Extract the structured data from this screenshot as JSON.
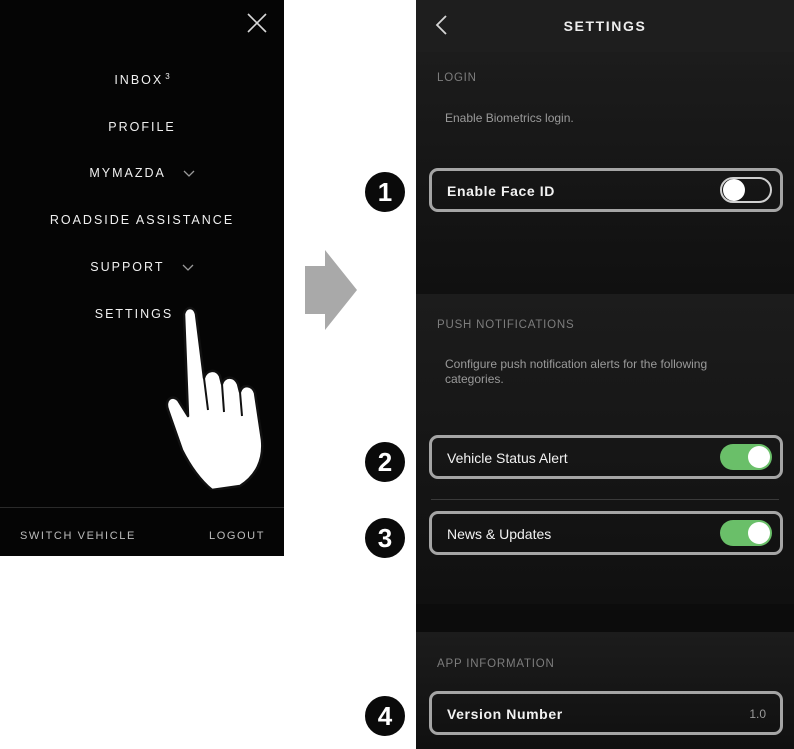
{
  "menu": {
    "items": [
      {
        "label": "INBOX",
        "badge": "3"
      },
      {
        "label": "PROFILE"
      },
      {
        "label": "MYMAZDA",
        "expandable": true
      },
      {
        "label": "ROADSIDE ASSISTANCE"
      },
      {
        "label": "SUPPORT",
        "expandable": true
      },
      {
        "label": "SETTINGS"
      }
    ],
    "footer": {
      "switch_vehicle": "SWITCH VEHICLE",
      "logout": "LOGOUT"
    }
  },
  "settings": {
    "title": "SETTINGS",
    "login": {
      "section_label": "LOGIN",
      "description": "Enable Biometrics login.",
      "face_id": {
        "label": "Enable Face ID",
        "enabled": false
      }
    },
    "push": {
      "section_label": "PUSH NOTIFICATIONS",
      "description": "Configure push notification alerts for the following categories.",
      "vehicle_status": {
        "label": "Vehicle Status Alert",
        "enabled": true
      },
      "news": {
        "label": "News & Updates",
        "enabled": true
      }
    },
    "app_info": {
      "section_label": "APP INFORMATION",
      "version": {
        "label": "Version Number",
        "value": "1.0"
      }
    }
  },
  "callouts": [
    "1",
    "2",
    "3",
    "4"
  ],
  "colors": {
    "toggle_on": "#6abf69",
    "highlight_border": "#a5a5a5",
    "background": "#161616"
  },
  "icons": [
    "close-icon",
    "chevron-down-icon",
    "back-chevron-icon",
    "arrow-right-icon",
    "pointing-hand-icon"
  ]
}
